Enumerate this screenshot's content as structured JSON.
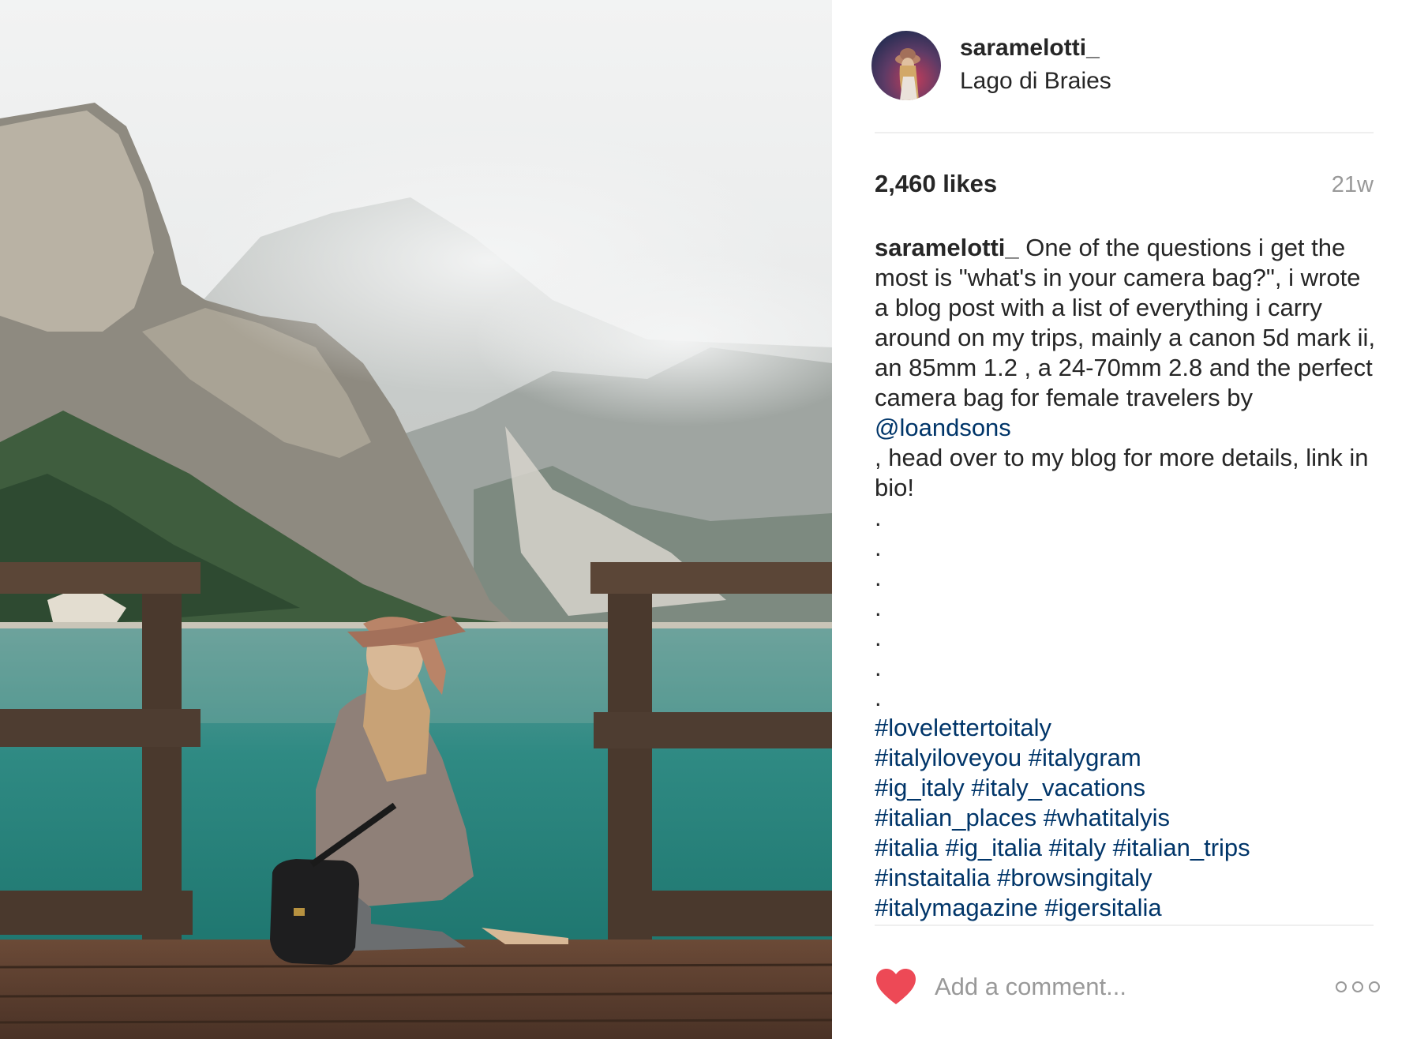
{
  "post": {
    "username": "saramelotti_",
    "location": "Lago di Braies",
    "likes": "2,460 likes",
    "age": "21w",
    "caption": {
      "username": "saramelotti_",
      "text_before_mention": " One of the questions i get the most is \"what's in your camera bag?\", i wrote a blog post with a list of everything i carry around on my trips, mainly a canon 5d mark ii, an 85mm 1.2 , a 24-70mm 2.8 and the perfect camera bag for female travelers by ",
      "mention": "@loandsons",
      "text_after_mention": "\n, head over to my blog for more details, link in bio!",
      "dots": [
        ".",
        ".",
        ".",
        ".",
        ".",
        ".",
        "."
      ],
      "hashtag_lines": [
        [
          "#lovelettertoitaly"
        ],
        [
          "#italyiloveyou",
          "#italygram"
        ],
        [
          "#ig_italy",
          "#italy_vacations"
        ],
        [
          "#italian_places",
          "#whatitalyis"
        ],
        [
          "#italia",
          "#ig_italia",
          "#italy",
          "#italian_trips"
        ],
        [
          "#instaitalia",
          "#browsingitaly"
        ],
        [
          "#italymagazine",
          "#igersitalia"
        ]
      ]
    }
  },
  "comment": {
    "placeholder": "Add a comment...",
    "like_icon": "heart-icon",
    "more_icon": "more-options-icon"
  },
  "colors": {
    "text": "#262626",
    "link": "#003569",
    "muted": "#999999",
    "heart": "#ed4956",
    "divider": "#efefef"
  }
}
